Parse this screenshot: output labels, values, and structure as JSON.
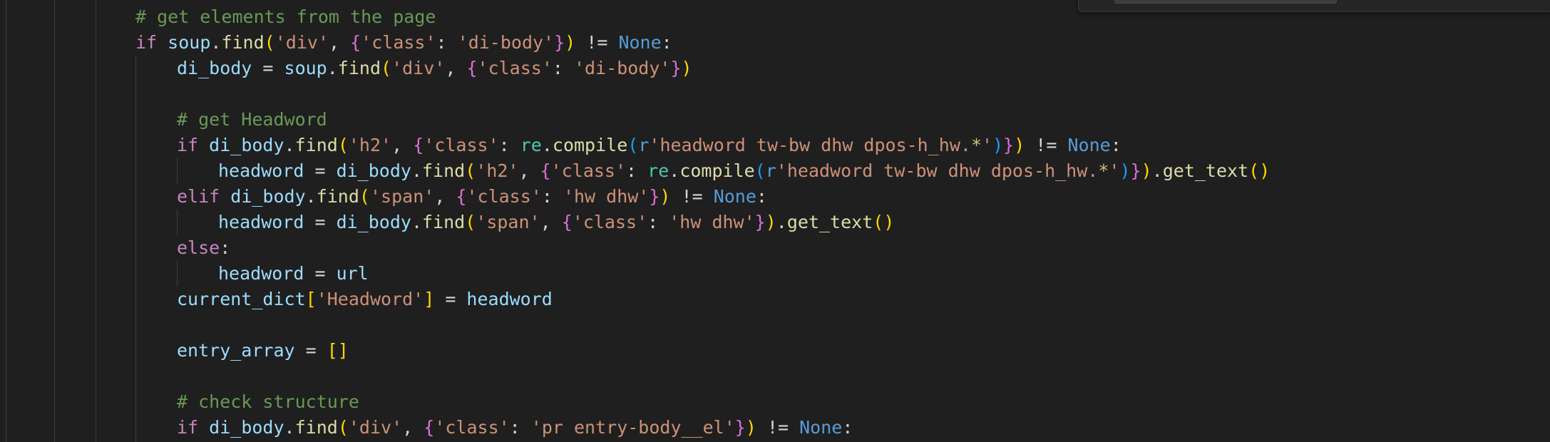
{
  "editor": {
    "language": "python",
    "lines": [
      {
        "indent": 0,
        "tokens": [
          {
            "t": "# get elements from the page",
            "c": "com"
          }
        ]
      },
      {
        "indent": 0,
        "tokens": [
          {
            "t": "if",
            "c": "kw"
          },
          {
            "t": " ",
            "c": "op"
          },
          {
            "t": "soup",
            "c": "var"
          },
          {
            "t": ".",
            "c": "op"
          },
          {
            "t": "find",
            "c": "fn"
          },
          {
            "t": "(",
            "c": "b1"
          },
          {
            "t": "'div'",
            "c": "str"
          },
          {
            "t": ", ",
            "c": "op"
          },
          {
            "t": "{",
            "c": "b2"
          },
          {
            "t": "'class'",
            "c": "str"
          },
          {
            "t": ": ",
            "c": "op"
          },
          {
            "t": "'di-body'",
            "c": "str"
          },
          {
            "t": "}",
            "c": "b2"
          },
          {
            "t": ")",
            "c": "b1"
          },
          {
            "t": " != ",
            "c": "op"
          },
          {
            "t": "None",
            "c": "const"
          },
          {
            "t": ":",
            "c": "op"
          }
        ]
      },
      {
        "indent": 1,
        "tokens": [
          {
            "t": "di_body",
            "c": "var"
          },
          {
            "t": " = ",
            "c": "op"
          },
          {
            "t": "soup",
            "c": "var"
          },
          {
            "t": ".",
            "c": "op"
          },
          {
            "t": "find",
            "c": "fn"
          },
          {
            "t": "(",
            "c": "b1"
          },
          {
            "t": "'div'",
            "c": "str"
          },
          {
            "t": ", ",
            "c": "op"
          },
          {
            "t": "{",
            "c": "b2"
          },
          {
            "t": "'class'",
            "c": "str"
          },
          {
            "t": ": ",
            "c": "op"
          },
          {
            "t": "'di-body'",
            "c": "str"
          },
          {
            "t": "}",
            "c": "b2"
          },
          {
            "t": ")",
            "c": "b1"
          }
        ]
      },
      {
        "indent": 1,
        "tokens": []
      },
      {
        "indent": 1,
        "tokens": [
          {
            "t": "# get Headword",
            "c": "com"
          }
        ]
      },
      {
        "indent": 1,
        "tokens": [
          {
            "t": "if",
            "c": "kw"
          },
          {
            "t": " ",
            "c": "op"
          },
          {
            "t": "di_body",
            "c": "var"
          },
          {
            "t": ".",
            "c": "op"
          },
          {
            "t": "find",
            "c": "fn"
          },
          {
            "t": "(",
            "c": "b1"
          },
          {
            "t": "'h2'",
            "c": "str"
          },
          {
            "t": ", ",
            "c": "op"
          },
          {
            "t": "{",
            "c": "b2"
          },
          {
            "t": "'class'",
            "c": "str"
          },
          {
            "t": ": ",
            "c": "op"
          },
          {
            "t": "re",
            "c": "mod"
          },
          {
            "t": ".",
            "c": "op"
          },
          {
            "t": "compile",
            "c": "fn"
          },
          {
            "t": "(",
            "c": "b3"
          },
          {
            "t": "r",
            "c": "const"
          },
          {
            "t": "'headword tw-bw dhw dpos-h_hw.",
            "c": "str"
          },
          {
            "t": "*",
            "c": "esc"
          },
          {
            "t": "'",
            "c": "str"
          },
          {
            "t": ")",
            "c": "b3"
          },
          {
            "t": "}",
            "c": "b2"
          },
          {
            "t": ")",
            "c": "b1"
          },
          {
            "t": " != ",
            "c": "op"
          },
          {
            "t": "None",
            "c": "const"
          },
          {
            "t": ":",
            "c": "op"
          }
        ]
      },
      {
        "indent": 2,
        "tokens": [
          {
            "t": "headword",
            "c": "var"
          },
          {
            "t": " = ",
            "c": "op"
          },
          {
            "t": "di_body",
            "c": "var"
          },
          {
            "t": ".",
            "c": "op"
          },
          {
            "t": "find",
            "c": "fn"
          },
          {
            "t": "(",
            "c": "b1"
          },
          {
            "t": "'h2'",
            "c": "str"
          },
          {
            "t": ", ",
            "c": "op"
          },
          {
            "t": "{",
            "c": "b2"
          },
          {
            "t": "'class'",
            "c": "str"
          },
          {
            "t": ": ",
            "c": "op"
          },
          {
            "t": "re",
            "c": "mod"
          },
          {
            "t": ".",
            "c": "op"
          },
          {
            "t": "compile",
            "c": "fn"
          },
          {
            "t": "(",
            "c": "b3"
          },
          {
            "t": "r",
            "c": "const"
          },
          {
            "t": "'headword tw-bw dhw dpos-h_hw.",
            "c": "str"
          },
          {
            "t": "*",
            "c": "esc"
          },
          {
            "t": "'",
            "c": "str"
          },
          {
            "t": ")",
            "c": "b3"
          },
          {
            "t": "}",
            "c": "b2"
          },
          {
            "t": ")",
            "c": "b1"
          },
          {
            "t": ".",
            "c": "op"
          },
          {
            "t": "get_text",
            "c": "fn"
          },
          {
            "t": "()",
            "c": "b1"
          }
        ]
      },
      {
        "indent": 1,
        "tokens": [
          {
            "t": "elif",
            "c": "kw"
          },
          {
            "t": " ",
            "c": "op"
          },
          {
            "t": "di_body",
            "c": "var"
          },
          {
            "t": ".",
            "c": "op"
          },
          {
            "t": "find",
            "c": "fn"
          },
          {
            "t": "(",
            "c": "b1"
          },
          {
            "t": "'span'",
            "c": "str"
          },
          {
            "t": ", ",
            "c": "op"
          },
          {
            "t": "{",
            "c": "b2"
          },
          {
            "t": "'class'",
            "c": "str"
          },
          {
            "t": ": ",
            "c": "op"
          },
          {
            "t": "'hw dhw'",
            "c": "str"
          },
          {
            "t": "}",
            "c": "b2"
          },
          {
            "t": ")",
            "c": "b1"
          },
          {
            "t": " != ",
            "c": "op"
          },
          {
            "t": "None",
            "c": "const"
          },
          {
            "t": ":",
            "c": "op"
          }
        ]
      },
      {
        "indent": 2,
        "tokens": [
          {
            "t": "headword",
            "c": "var"
          },
          {
            "t": " = ",
            "c": "op"
          },
          {
            "t": "di_body",
            "c": "var"
          },
          {
            "t": ".",
            "c": "op"
          },
          {
            "t": "find",
            "c": "fn"
          },
          {
            "t": "(",
            "c": "b1"
          },
          {
            "t": "'span'",
            "c": "str"
          },
          {
            "t": ", ",
            "c": "op"
          },
          {
            "t": "{",
            "c": "b2"
          },
          {
            "t": "'class'",
            "c": "str"
          },
          {
            "t": ": ",
            "c": "op"
          },
          {
            "t": "'hw dhw'",
            "c": "str"
          },
          {
            "t": "}",
            "c": "b2"
          },
          {
            "t": ")",
            "c": "b1"
          },
          {
            "t": ".",
            "c": "op"
          },
          {
            "t": "get_text",
            "c": "fn"
          },
          {
            "t": "()",
            "c": "b1"
          }
        ]
      },
      {
        "indent": 1,
        "tokens": [
          {
            "t": "else",
            "c": "kw"
          },
          {
            "t": ":",
            "c": "op"
          }
        ]
      },
      {
        "indent": 2,
        "tokens": [
          {
            "t": "headword",
            "c": "var"
          },
          {
            "t": " = ",
            "c": "op"
          },
          {
            "t": "url",
            "c": "var"
          }
        ]
      },
      {
        "indent": 1,
        "tokens": [
          {
            "t": "current_dict",
            "c": "var"
          },
          {
            "t": "[",
            "c": "b1"
          },
          {
            "t": "'Headword'",
            "c": "str"
          },
          {
            "t": "]",
            "c": "b1"
          },
          {
            "t": " = ",
            "c": "op"
          },
          {
            "t": "headword",
            "c": "var"
          }
        ]
      },
      {
        "indent": 1,
        "tokens": []
      },
      {
        "indent": 1,
        "tokens": [
          {
            "t": "entry_array",
            "c": "var"
          },
          {
            "t": " = ",
            "c": "op"
          },
          {
            "t": "[]",
            "c": "b1"
          }
        ]
      },
      {
        "indent": 1,
        "tokens": []
      },
      {
        "indent": 1,
        "tokens": [
          {
            "t": "# check structure",
            "c": "com"
          }
        ]
      },
      {
        "indent": 1,
        "tokens": [
          {
            "t": "if",
            "c": "kw"
          },
          {
            "t": " ",
            "c": "op"
          },
          {
            "t": "di_body",
            "c": "var"
          },
          {
            "t": ".",
            "c": "op"
          },
          {
            "t": "find",
            "c": "fn"
          },
          {
            "t": "(",
            "c": "b1"
          },
          {
            "t": "'div'",
            "c": "str"
          },
          {
            "t": ", ",
            "c": "op"
          },
          {
            "t": "{",
            "c": "b2"
          },
          {
            "t": "'class'",
            "c": "str"
          },
          {
            "t": ": ",
            "c": "op"
          },
          {
            "t": "'pr entry-body__el'",
            "c": "str"
          },
          {
            "t": "}",
            "c": "b2"
          },
          {
            "t": ")",
            "c": "b1"
          },
          {
            "t": " != ",
            "c": "op"
          },
          {
            "t": "None",
            "c": "const"
          },
          {
            "t": ":",
            "c": "op"
          }
        ]
      }
    ]
  },
  "colors": {
    "background": "#1f1f1f",
    "keyword": "#c586c0",
    "variable": "#9cdcfe",
    "function": "#dcdcaa",
    "string": "#ce9178",
    "comment": "#6a9955",
    "constant": "#569cd6",
    "bracket_1": "#ffd700",
    "bracket_2": "#da70d6",
    "bracket_3": "#179fff",
    "module": "#4ec9b0"
  }
}
